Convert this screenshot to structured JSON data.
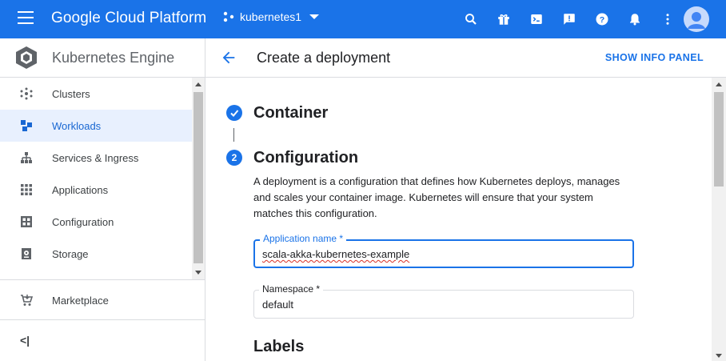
{
  "topbar": {
    "brand": "Google Cloud Platform",
    "project": "kubernetes1",
    "icons": [
      "search-icon",
      "gift-icon",
      "cloud-shell-icon",
      "feedback-icon",
      "help-icon",
      "notifications-icon",
      "more-vert-icon"
    ],
    "accent": "#1a73e8"
  },
  "sidebar": {
    "title": "Kubernetes Engine",
    "items": [
      {
        "label": "Clusters",
        "icon": "clusters-icon"
      },
      {
        "label": "Workloads",
        "icon": "workloads-icon",
        "active": true
      },
      {
        "label": "Services & Ingress",
        "icon": "services-icon"
      },
      {
        "label": "Applications",
        "icon": "applications-icon"
      },
      {
        "label": "Configuration",
        "icon": "configuration-icon"
      },
      {
        "label": "Storage",
        "icon": "storage-icon"
      }
    ],
    "marketplace": "Marketplace",
    "collapse_glyph": "<|"
  },
  "main": {
    "title": "Create a deployment",
    "info_panel": "SHOW INFO PANEL",
    "steps": [
      {
        "title": "Container",
        "status": "done"
      },
      {
        "number": "2",
        "title": "Configuration"
      }
    ],
    "description": "A deployment is a configuration that defines how Kubernetes deploys, manages and scales your container image. Kubernetes will ensure that your system matches this configuration.",
    "app_name": {
      "label": "Application name *",
      "value": "scala-akka-kubernetes-example"
    },
    "namespace": {
      "label": "Namespace *",
      "value": "default"
    },
    "labels_heading": "Labels"
  }
}
